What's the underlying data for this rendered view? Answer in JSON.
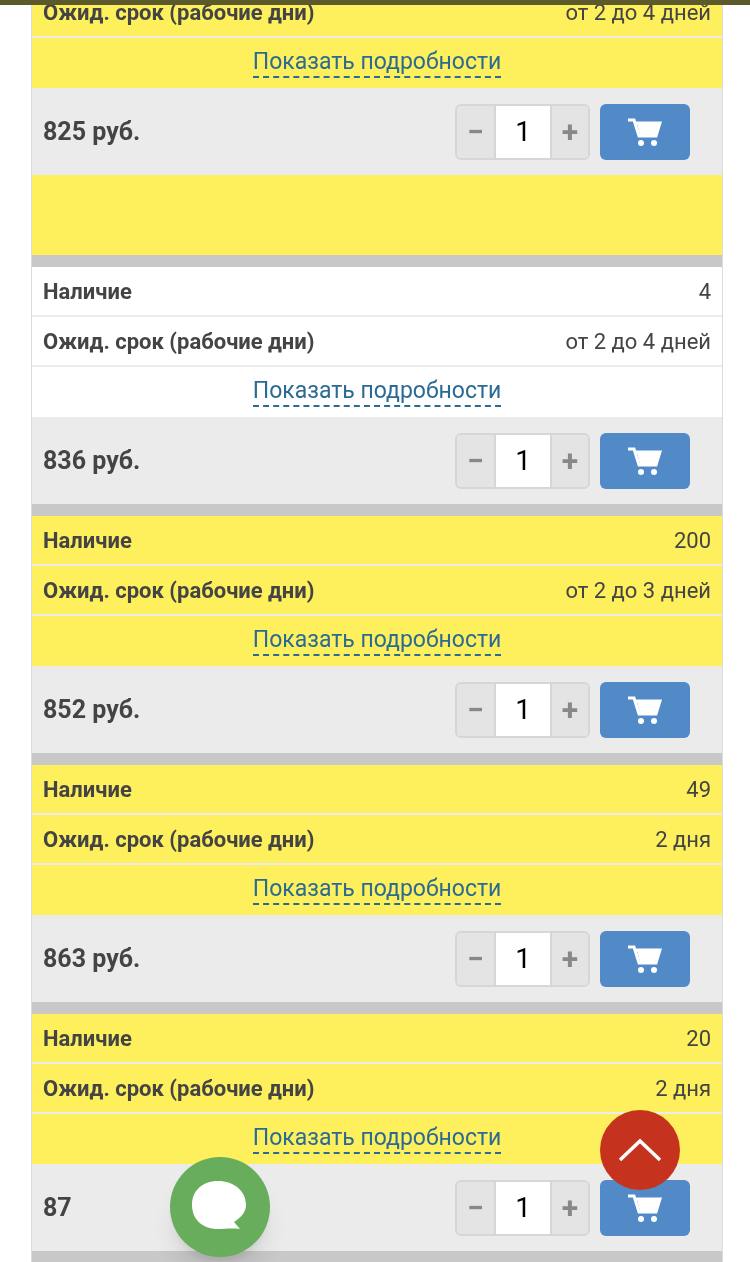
{
  "offers": [
    {
      "highlighted": true,
      "blank_area": true,
      "rows": [
        {
          "label": "Ожид. срок (рабочие дни)",
          "value": "от 2 до 4 дней"
        }
      ],
      "details_link": "Показать подробности",
      "price": "825 руб.",
      "quantity": "1",
      "minus": "−",
      "plus": "+"
    },
    {
      "highlighted": false,
      "blank_area": false,
      "rows": [
        {
          "label": "Наличие",
          "value": "4"
        },
        {
          "label": "Ожид. срок (рабочие дни)",
          "value": "от 2 до 4 дней"
        }
      ],
      "details_link": "Показать подробности",
      "price": "836 руб.",
      "quantity": "1",
      "minus": "−",
      "plus": "+"
    },
    {
      "highlighted": true,
      "blank_area": false,
      "rows": [
        {
          "label": "Наличие",
          "value": "200"
        },
        {
          "label": "Ожид. срок (рабочие дни)",
          "value": "от 2 до 3 дней"
        }
      ],
      "details_link": "Показать подробности",
      "price": "852 руб.",
      "quantity": "1",
      "minus": "−",
      "plus": "+"
    },
    {
      "highlighted": true,
      "blank_area": false,
      "rows": [
        {
          "label": "Наличие",
          "value": "49"
        },
        {
          "label": "Ожид. срок (рабочие дни)",
          "value": "2 дня"
        }
      ],
      "details_link": "Показать подробности",
      "price": "863 руб.",
      "quantity": "1",
      "minus": "−",
      "plus": "+"
    },
    {
      "highlighted": true,
      "blank_area": false,
      "rows": [
        {
          "label": "Наличие",
          "value": "20"
        },
        {
          "label": "Ожид. срок (рабочие дни)",
          "value": "2 дня"
        }
      ],
      "details_link": "Показать подробности",
      "price": "87",
      "quantity": "1",
      "minus": "−",
      "plus": "+"
    }
  ]
}
